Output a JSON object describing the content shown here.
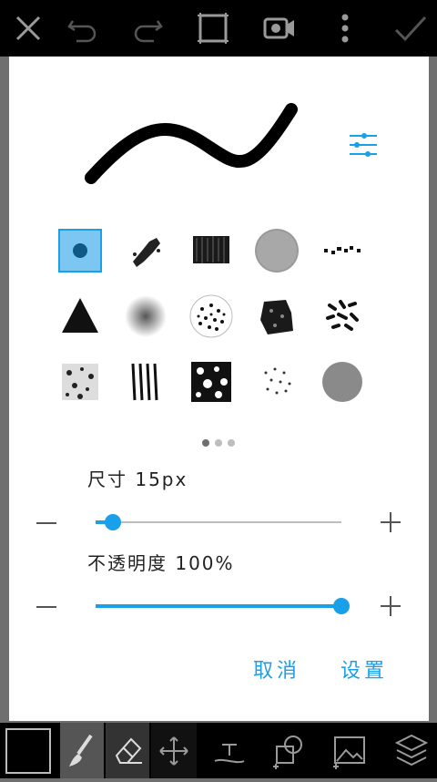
{
  "toolbar": {
    "close_icon": "close-icon",
    "undo_icon": "undo-icon",
    "redo_icon": "redo-icon",
    "crop_icon": "crop-frame-icon",
    "video_icon": "video-camera-icon",
    "more_icon": "more-vertical-icon",
    "confirm_icon": "checkmark-icon"
  },
  "brush_dialog": {
    "brushes": [
      "round-brush",
      "chalk-brush",
      "charcoal-brush",
      "spray-brush",
      "dotted-brush",
      "triangle-brush",
      "soft-brush",
      "speckle-brush",
      "grunge-brush",
      "scatter-brush",
      "texture-brush",
      "stroke-lines-brush",
      "splatter-brush",
      "dust-brush",
      "solid-circle-brush"
    ],
    "selected_brush": 0,
    "page_count": 3,
    "current_page": 1,
    "size_label": "尺寸 15px",
    "size_value": 0.07,
    "opacity_label": "不透明度 100%",
    "opacity_value": 1.0,
    "cancel_label": "取消",
    "confirm_label": "设置",
    "accent_color": "#1aa0e8"
  },
  "bottom_toolbar": {
    "color_swatch": "#000000",
    "tools": [
      "brush-icon",
      "eraser-icon",
      "move-icon",
      "text-icon",
      "sticker-icon",
      "image-icon",
      "layers-icon"
    ],
    "active_tool": "brush-icon"
  }
}
